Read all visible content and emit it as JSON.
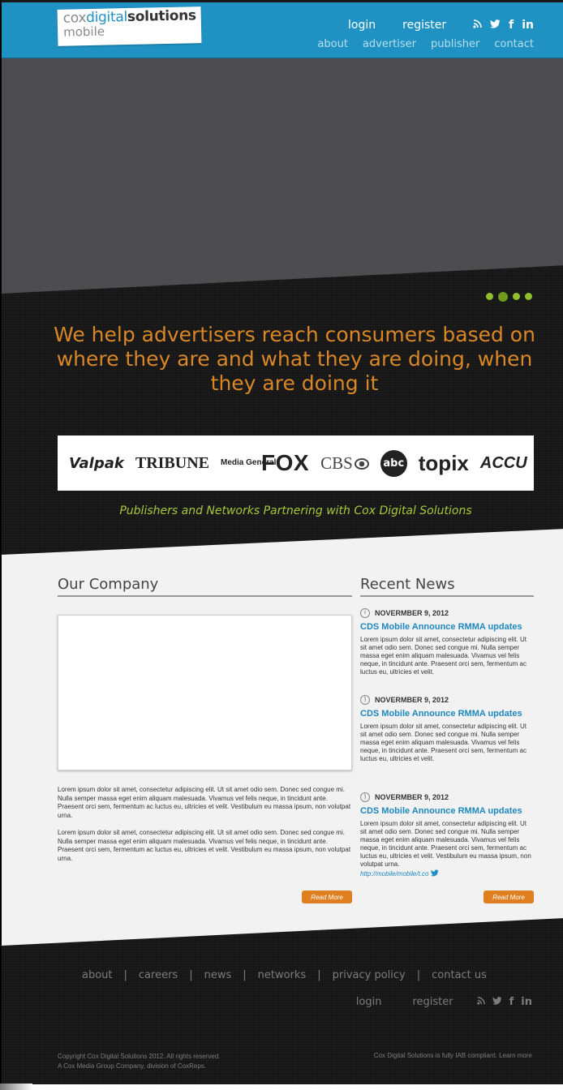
{
  "header": {
    "logo": {
      "part1": "cox",
      "part2": "digital",
      "part3": "solutions",
      "line2": "mobile"
    },
    "login": "login",
    "register": "register",
    "social": {
      "rss": "∵",
      "twitter": "▸",
      "facebook": "f",
      "linkedin": "in"
    },
    "nav": [
      "about",
      "advertiser",
      "publisher",
      "contact"
    ]
  },
  "hero": {
    "slides_total": 4,
    "active_slide": 2,
    "tagline": "We help advertisers reach consumers based on where they are and what they are doing, when they are doing it"
  },
  "partners": {
    "logos": [
      "Valpak",
      "TRIBUNE",
      "Media General",
      "FOX",
      "CBS",
      "abc",
      "topix",
      "ACCU"
    ],
    "caption": "Publishers and Networks Partnering with Cox Digital Solutions"
  },
  "company": {
    "heading": "Our Company",
    "para1": "Lorem ipsum dolor sit amet, consectetur adipiscing elit. Ut sit amet odio sem. Donec sed congue mi. Nulla semper massa eget enim aliquam malesuada. Vivamus vel felis neque, in tincidunt ante. Praesent orci sem, fermentum ac luctus eu, ultricies et velit. Vestibulum eu massa ipsum, non volutpat urna.",
    "para2": "Lorem ipsum dolor sit amet, consectetur adipiscing elit. Ut sit amet odio sem. Donec sed congue mi. Nulla semper massa eget enim aliquam malesuada. Vivamus vel felis neque, in tincidunt ante. Praesent orci sem, fermentum ac luctus eu, ultricies et velit. Vestibulum eu massa ipsum, non volutpat urna.",
    "read_more": "Read More"
  },
  "news": {
    "heading": "Recent News",
    "items": [
      {
        "icon": "info-icon",
        "date": "NOVERMBER 9, 2012",
        "title": "CDS Mobile Announce RMMA updates",
        "body": "Lorem ipsum dolor sit amet, consectetur adipiscing elit. Ut sit amet odio sem. Donec sed congue mi. Nulla semper massa eget enim aliquam malesuada. Vivamus vel felis neque, in tincidunt ante. Praesent orci sem, fermentum ac luctus eu, ultricies et velit."
      },
      {
        "icon": "rss-icon",
        "date": "NOVERMBER 9, 2012",
        "title": "CDS Mobile Announce RMMA updates",
        "body": "Lorem ipsum dolor sit amet, consectetur adipiscing elit. Ut sit amet odio sem. Donec sed congue mi. Nulla semper massa eget enim aliquam malesuada. Vivamus vel felis neque, in tincidunt ante. Praesent orci sem, fermentum ac luctus eu, ultricies et velit."
      },
      {
        "icon": "rss-icon",
        "date": "NOVERMBER 9, 2012",
        "title": "CDS Mobile Announce RMMA updates",
        "body": "Lorem ipsum dolor sit amet, consectetur adipiscing elit. Ut sit amet odio sem. Donec sed congue mi. Nulla semper massa eget enim aliquam malesuada. Vivamus vel felis neque, in tincidunt ante. Praesent orci sem, fermentum ac luctus eu, ultricies et velit. Vestibulum eu massa ipsum, non volutpat urna.",
        "link": "http://mobile/mobile/t.co"
      }
    ],
    "read_more": "Read More"
  },
  "footer": {
    "nav": [
      "about",
      "careers",
      "news",
      "networks",
      "privacy policy",
      "contact us"
    ],
    "login": "login",
    "register": "register",
    "copyright_line1": "Copyright  Cox Digital Solutions 2012. All rights reserved.",
    "copyright_line2": "A Cox Media Group Company, division of CoxReps.",
    "iab": "Cox Digital Solutions is fully IAB compliant. Learn more"
  },
  "colors": {
    "header_blue": "#1f92c3",
    "tagline_orange": "#d98726",
    "accent_green": "#a7c83b",
    "button_orange": "#df7f1f",
    "news_link_blue": "#1f88bf"
  }
}
